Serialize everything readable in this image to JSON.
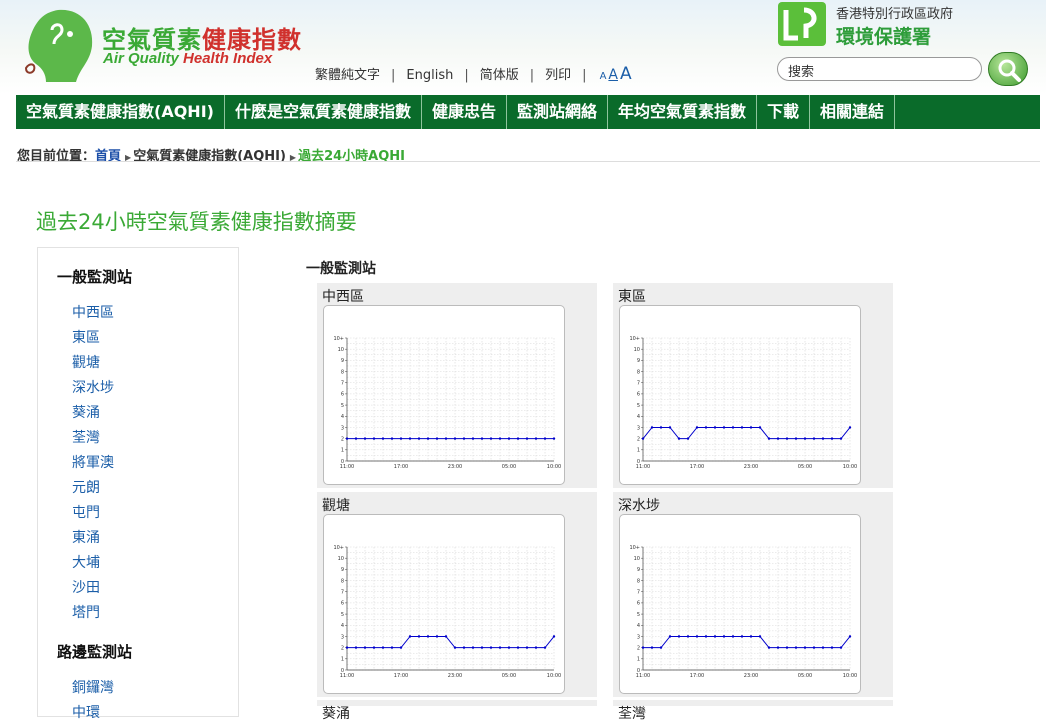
{
  "header": {
    "title_zh_part1": "空氣質素",
    "title_zh_part2": "健康指數",
    "title_en_part1": "Air Quality ",
    "title_en_part2": "Health Index",
    "lang_links": [
      "繁體純文字",
      "English",
      "简体版",
      "列印"
    ],
    "font_sizes": [
      "A",
      "A",
      "A"
    ],
    "gov_text": "香港特別行政區政府",
    "dept_name": "環境保護署",
    "search_placeholder": "搜索",
    "colors": {
      "green": "#3aa935",
      "red": "#d0312d",
      "nav": "#0a6b2a"
    }
  },
  "nav": {
    "items": [
      "空氣質素健康指數(AQHI)",
      "什麼是空氣質素健康指數",
      "健康忠告",
      "監測站網絡",
      "年均空氣質素指數",
      "下載",
      "相關連結"
    ]
  },
  "breadcrumb": {
    "label": "您目前位置：",
    "home": "首頁",
    "level1": "空氣質素健康指數(AQHI)",
    "current": "過去24小時AQHI"
  },
  "page_title": "過去24小時空氣質素健康指數摘要",
  "sidebar": {
    "general_heading": "一般監測站",
    "general_stations": [
      "中西區",
      "東區",
      "觀塘",
      "深水埗",
      "葵涌",
      "荃灣",
      "將軍澳",
      "元朗",
      "屯門",
      "東涌",
      "大埔",
      "沙田",
      "塔門"
    ],
    "roadside_heading": "路邊監測站",
    "roadside_stations": [
      "銅鑼灣",
      "中環"
    ]
  },
  "main": {
    "section_title": "一般監測站",
    "partial_labels": [
      "葵涌",
      "荃灣"
    ]
  },
  "chart_data": [
    {
      "type": "line",
      "title": "中西區",
      "x": [
        "11:00",
        "12:00",
        "13:00",
        "14:00",
        "15:00",
        "16:00",
        "17:00",
        "18:00",
        "19:00",
        "20:00",
        "21:00",
        "22:00",
        "23:00",
        "00:00",
        "01:00",
        "02:00",
        "03:00",
        "04:00",
        "05:00",
        "06:00",
        "07:00",
        "08:00",
        "09:00",
        "10:00"
      ],
      "x_tick_labels": [
        "11:00",
        "17:00",
        "23:00",
        "05:00",
        "10:00"
      ],
      "y_tick_labels": [
        "0",
        "1",
        "2",
        "3",
        "4",
        "5",
        "6",
        "7",
        "8",
        "9",
        "10",
        "10+"
      ],
      "values": [
        2,
        2,
        2,
        2,
        2,
        2,
        2,
        2,
        2,
        2,
        2,
        2,
        2,
        2,
        2,
        2,
        2,
        2,
        2,
        2,
        2,
        2,
        2,
        2
      ],
      "ylim": [
        0,
        11
      ],
      "color": "#0000cc"
    },
    {
      "type": "line",
      "title": "東區",
      "x": [
        "11:00",
        "12:00",
        "13:00",
        "14:00",
        "15:00",
        "16:00",
        "17:00",
        "18:00",
        "19:00",
        "20:00",
        "21:00",
        "22:00",
        "23:00",
        "00:00",
        "01:00",
        "02:00",
        "03:00",
        "04:00",
        "05:00",
        "06:00",
        "07:00",
        "08:00",
        "09:00",
        "10:00"
      ],
      "x_tick_labels": [
        "11:00",
        "17:00",
        "23:00",
        "05:00",
        "10:00"
      ],
      "y_tick_labels": [
        "0",
        "1",
        "2",
        "3",
        "4",
        "5",
        "6",
        "7",
        "8",
        "9",
        "10",
        "10+"
      ],
      "values": [
        2,
        3,
        3,
        3,
        2,
        2,
        3,
        3,
        3,
        3,
        3,
        3,
        3,
        3,
        2,
        2,
        2,
        2,
        2,
        2,
        2,
        2,
        2,
        3
      ],
      "ylim": [
        0,
        11
      ],
      "color": "#0000cc"
    },
    {
      "type": "line",
      "title": "觀塘",
      "x": [
        "11:00",
        "12:00",
        "13:00",
        "14:00",
        "15:00",
        "16:00",
        "17:00",
        "18:00",
        "19:00",
        "20:00",
        "21:00",
        "22:00",
        "23:00",
        "00:00",
        "01:00",
        "02:00",
        "03:00",
        "04:00",
        "05:00",
        "06:00",
        "07:00",
        "08:00",
        "09:00",
        "10:00"
      ],
      "x_tick_labels": [
        "11:00",
        "17:00",
        "23:00",
        "05:00",
        "10:00"
      ],
      "y_tick_labels": [
        "0",
        "1",
        "2",
        "3",
        "4",
        "5",
        "6",
        "7",
        "8",
        "9",
        "10",
        "10+"
      ],
      "values": [
        2,
        2,
        2,
        2,
        2,
        2,
        2,
        3,
        3,
        3,
        3,
        3,
        2,
        2,
        2,
        2,
        2,
        2,
        2,
        2,
        2,
        2,
        2,
        3
      ],
      "ylim": [
        0,
        11
      ],
      "color": "#0000cc"
    },
    {
      "type": "line",
      "title": "深水埗",
      "x": [
        "11:00",
        "12:00",
        "13:00",
        "14:00",
        "15:00",
        "16:00",
        "17:00",
        "18:00",
        "19:00",
        "20:00",
        "21:00",
        "22:00",
        "23:00",
        "00:00",
        "01:00",
        "02:00",
        "03:00",
        "04:00",
        "05:00",
        "06:00",
        "07:00",
        "08:00",
        "09:00",
        "10:00"
      ],
      "x_tick_labels": [
        "11:00",
        "17:00",
        "23:00",
        "05:00",
        "10:00"
      ],
      "y_tick_labels": [
        "0",
        "1",
        "2",
        "3",
        "4",
        "5",
        "6",
        "7",
        "8",
        "9",
        "10",
        "10+"
      ],
      "values": [
        2,
        2,
        2,
        3,
        3,
        3,
        3,
        3,
        3,
        3,
        3,
        3,
        3,
        3,
        2,
        2,
        2,
        2,
        2,
        2,
        2,
        2,
        2,
        3
      ],
      "ylim": [
        0,
        11
      ],
      "color": "#0000cc"
    }
  ]
}
